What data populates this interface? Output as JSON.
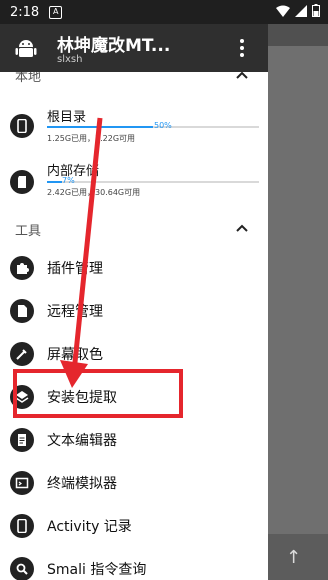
{
  "status_bar": {
    "time": "2:18",
    "notification_glyph": "A"
  },
  "app_bar": {
    "title": "林坤魔改MT...",
    "subtitle": "slxsh"
  },
  "sections": {
    "local": "本地",
    "tools": "工具"
  },
  "storage": [
    {
      "name": "根目录",
      "percent_label": "50%",
      "usage_fraction": 0.5,
      "usage": "1.25G已用，1.22G可用"
    },
    {
      "name": "内部存储",
      "percent_label": "7%",
      "usage_fraction": 0.07,
      "usage": "2.42G已用，30.64G可用"
    }
  ],
  "tools": [
    {
      "label": "插件管理",
      "icon": "puzzle-icon"
    },
    {
      "label": "远程管理",
      "icon": "file-icon"
    },
    {
      "label": "屏幕取色",
      "icon": "eyedropper-icon"
    },
    {
      "label": "安装包提取",
      "icon": "layers-icon"
    },
    {
      "label": "文本编辑器",
      "icon": "document-icon"
    },
    {
      "label": "终端模拟器",
      "icon": "terminal-icon"
    },
    {
      "label": "Activity 记录",
      "icon": "phone-icon"
    },
    {
      "label": "Smali 指令查询",
      "icon": "search-icon"
    }
  ],
  "colors": {
    "accent": "#2196f3",
    "highlight": "#e5262d",
    "app_bar": "#2f2f2f"
  }
}
